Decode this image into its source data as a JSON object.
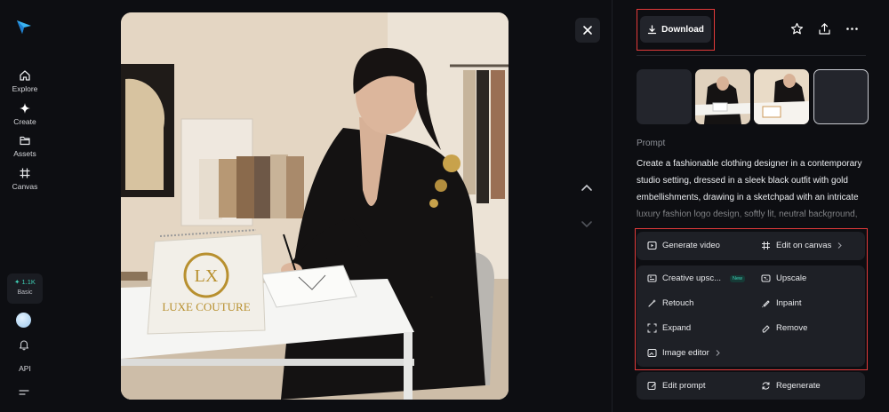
{
  "sidebar": {
    "nav": [
      {
        "label": "Explore",
        "icon": "home-icon"
      },
      {
        "label": "Create",
        "icon": "sparkle-icon"
      },
      {
        "label": "Assets",
        "icon": "folder-icon"
      },
      {
        "label": "Canvas",
        "icon": "canvas-icon"
      }
    ],
    "credits": "1.1K",
    "plan": "Basic",
    "api_label": "API"
  },
  "image": {
    "logo_text": "LUXE COUTURE",
    "logo_monogram": "LX"
  },
  "toolbar": {
    "download_label": "Download"
  },
  "prompt": {
    "heading": "Prompt",
    "text": "Create a fashionable clothing designer in a contemporary studio setting, dressed in a sleek black outfit with gold embellishments, drawing in a sketchpad with an intricate luxury fashion logo design, softly lit, neutral background,"
  },
  "actions": {
    "generate_video": "Generate video",
    "edit_on_canvas": "Edit on canvas",
    "creative_upscale": "Creative upsc...",
    "new_badge": "New",
    "upscale": "Upscale",
    "retouch": "Retouch",
    "inpaint": "Inpaint",
    "expand": "Expand",
    "remove": "Remove",
    "image_editor": "Image editor",
    "edit_prompt": "Edit prompt",
    "regenerate": "Regenerate"
  },
  "colors": {
    "background": "#0d0e12",
    "card": "#1e2026",
    "accent": "#3fd0b6",
    "highlight": "#e23a3a"
  }
}
